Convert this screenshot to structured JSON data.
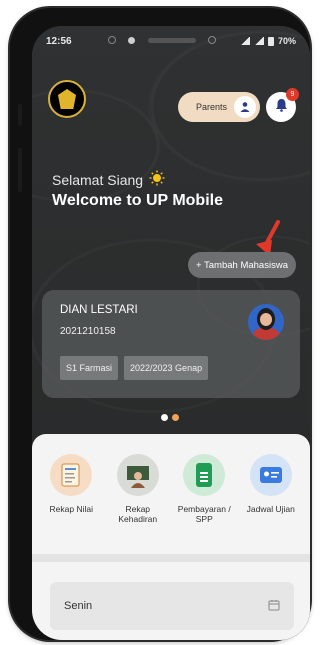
{
  "status": {
    "time": "12:56",
    "battery": "70%"
  },
  "header": {
    "parents_label": "Parents",
    "notification_count": "9"
  },
  "greeting": {
    "salutation": "Selamat Siang",
    "welcome": "Welcome to UP Mobile"
  },
  "add_student": {
    "label": "+ Tambah Mahasiswa"
  },
  "student": {
    "name": "DIAN LESTARI",
    "nim": "2021210158",
    "program": "S1 Farmasi",
    "semester": "2022/2023 Genap"
  },
  "carousel": {
    "active_color": "#f0a35a",
    "inactive_color": "#ffffff"
  },
  "menu": [
    {
      "label": "Rekap Nilai",
      "icon": "report-card-icon"
    },
    {
      "label": "Rekap Kehadiran",
      "icon": "attendance-icon"
    },
    {
      "label": "Pembayaran / SPP",
      "icon": "payment-icon"
    },
    {
      "label": "Jadwal Ujian",
      "icon": "exam-schedule-icon"
    }
  ],
  "schedule": {
    "day": "Senin"
  },
  "colors": {
    "accent_red": "#e0392b",
    "pill_bg": "#f1dcc3",
    "bg_dark": "#2b2d2e"
  }
}
